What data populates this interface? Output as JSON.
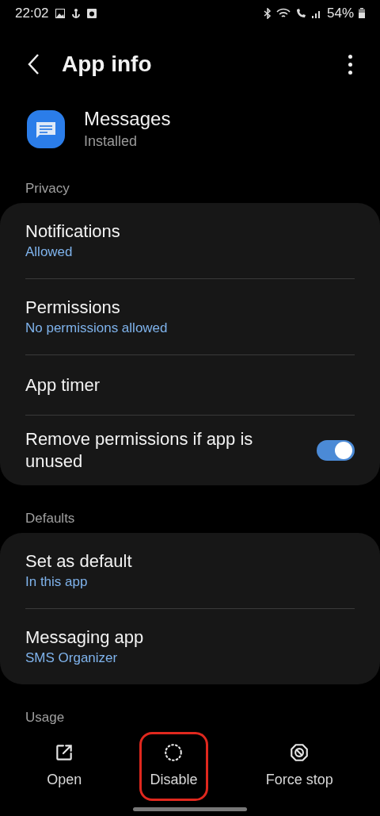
{
  "status_bar": {
    "time": "22:02",
    "battery": "54%"
  },
  "header": {
    "title": "App info"
  },
  "app": {
    "name": "Messages",
    "status": "Installed"
  },
  "sections": [
    {
      "title": "Privacy",
      "items": [
        {
          "kind": "link",
          "title": "Notifications",
          "subtitle": "Allowed"
        },
        {
          "kind": "link",
          "title": "Permissions",
          "subtitle": "No permissions allowed"
        },
        {
          "kind": "link",
          "title": "App timer"
        },
        {
          "kind": "toggle",
          "title": "Remove permissions if app is unused",
          "on": true
        }
      ]
    },
    {
      "title": "Defaults",
      "items": [
        {
          "kind": "link",
          "title": "Set as default",
          "subtitle": "In this app"
        },
        {
          "kind": "link",
          "title": "Messaging app",
          "subtitle": "SMS Organizer"
        }
      ]
    },
    {
      "title": "Usage"
    }
  ],
  "actions": [
    {
      "kind": "open",
      "label": "Open",
      "highlighted": false
    },
    {
      "kind": "disable",
      "label": "Disable",
      "highlighted": true
    },
    {
      "kind": "stop",
      "label": "Force stop",
      "highlighted": false
    }
  ]
}
